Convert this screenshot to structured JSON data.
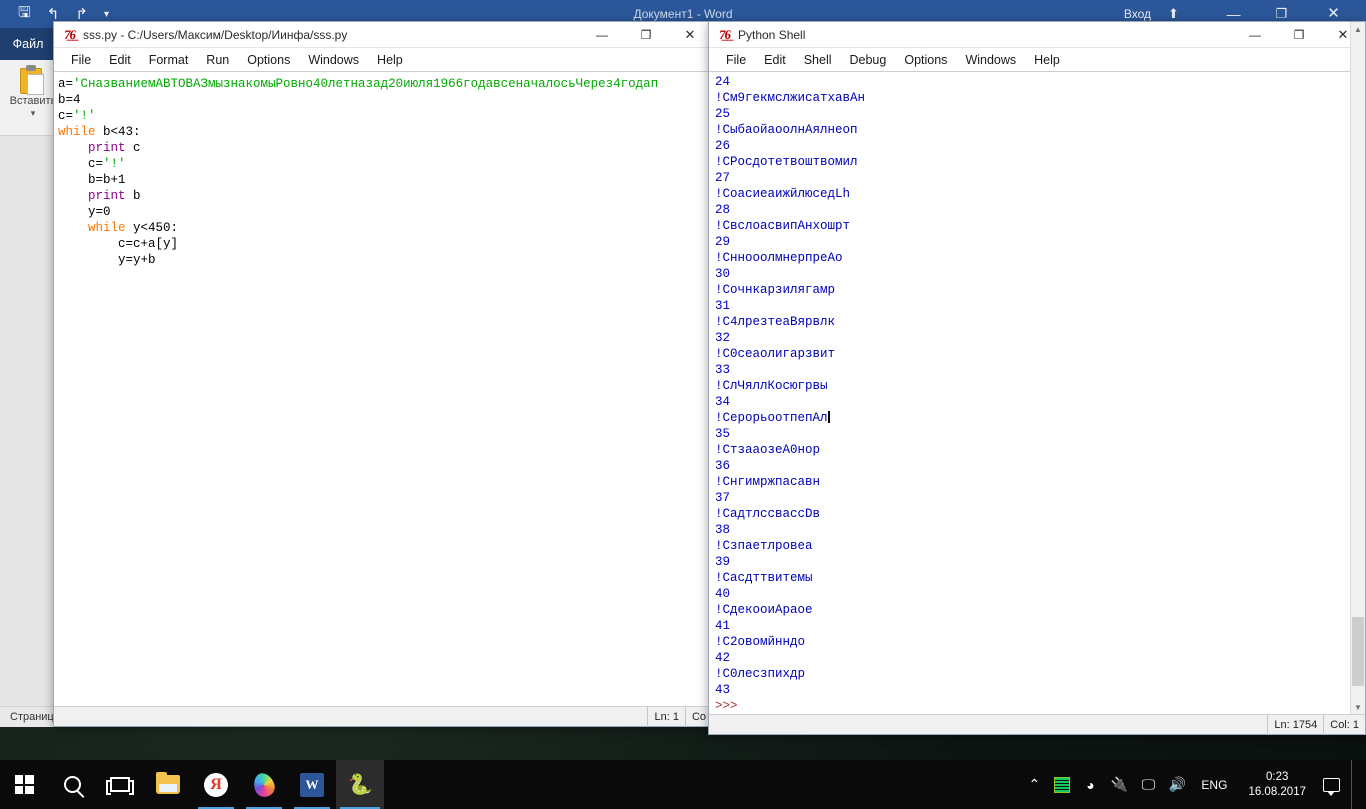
{
  "word": {
    "title": "Документ1 - Word",
    "signin": "Вход",
    "file_tab": "Файл",
    "paste_label": "Вставить",
    "paste_caret": "▾",
    "qat": {
      "save": "🖫",
      "undo": "↰",
      "redo": "↱",
      "more": "▾"
    },
    "titlebar_buttons": {
      "ribbon": "⬆",
      "minimize": "—",
      "maximize": "❐",
      "close": "✕"
    },
    "status": "Страниц"
  },
  "editor": {
    "window_title": "sss.py - C:/Users/Максим/Desktop/Иинфа/sss.py",
    "py_logo": "7̶6̶",
    "menus": [
      "File",
      "Edit",
      "Format",
      "Run",
      "Options",
      "Windows",
      "Help"
    ],
    "buttons": {
      "minimize": "—",
      "maximize": "❐",
      "close": "✕"
    },
    "status": {
      "ln": "Ln: 1",
      "col": "Co"
    },
    "code_lines": [
      [
        {
          "t": "a=",
          "c": "def"
        },
        {
          "t": "'СназваниемАВТОВАЗмызнакомыРовно40летназад20июля1966годавсеначалосьЧерез4годап",
          "c": "str"
        }
      ],
      [
        {
          "t": "b=4",
          "c": "def"
        }
      ],
      [
        {
          "t": "c=",
          "c": "def"
        },
        {
          "t": "'!'",
          "c": "str"
        }
      ],
      [
        {
          "t": "while",
          "c": "kw"
        },
        {
          "t": " b<43:",
          "c": "def"
        }
      ],
      [
        {
          "t": "    ",
          "c": "def"
        },
        {
          "t": "print",
          "c": "bi"
        },
        {
          "t": " c",
          "c": "def"
        }
      ],
      [
        {
          "t": "    c=",
          "c": "def"
        },
        {
          "t": "'!'",
          "c": "str"
        }
      ],
      [
        {
          "t": "    b=b+1",
          "c": "def"
        }
      ],
      [
        {
          "t": "    ",
          "c": "def"
        },
        {
          "t": "print",
          "c": "bi"
        },
        {
          "t": " b",
          "c": "def"
        }
      ],
      [
        {
          "t": "    y=0",
          "c": "def"
        }
      ],
      [
        {
          "t": "    ",
          "c": "def"
        },
        {
          "t": "while",
          "c": "kw"
        },
        {
          "t": " y<450:",
          "c": "def"
        }
      ],
      [
        {
          "t": "        c=c+a[y]",
          "c": "def"
        }
      ],
      [
        {
          "t": "        y=y+b",
          "c": "def"
        }
      ]
    ]
  },
  "shell": {
    "window_title": "Python Shell",
    "menus": [
      "File",
      "Edit",
      "Shell",
      "Debug",
      "Options",
      "Windows",
      "Help"
    ],
    "buttons": {
      "minimize": "—",
      "maximize": "❐",
      "close": "✕"
    },
    "status": {
      "ln": "Ln: 1754",
      "col": "Col: 1"
    },
    "prompt": ">>>",
    "output_lines": [
      "24",
      "!См9гекмслжисатхавАн",
      "25",
      "!СыбаойаоолнАялнеоп",
      "26",
      "!СРосдотетвоштвомил",
      "27",
      "!СоасиеаижйлюседLh",
      "28",
      "!СвслоасвипАнхошрт",
      "29",
      "!СннооолмнерпреАо",
      "30",
      "!Сочнкарзилягамр",
      "31",
      "!С4лрезтеаВярвлк",
      "32",
      "!С0сеаолигарзвит",
      "33",
      "!СлЧяллКосюгрвы",
      "34",
      "!СерорьоотпепАл",
      "35",
      "!СтзааозеА0нор",
      "36",
      "!Снгимржпасавн",
      "37",
      "!СадтлссвассDв",
      "38",
      "!Сзпаетлровеа",
      "39",
      "!Сасдттвитемы",
      "40",
      "!СдекооиАраое",
      "41",
      "!С2овомйнндо",
      "42",
      "!С0лесзпихдр",
      "43"
    ],
    "caret_line_index": 21
  },
  "taskbar": {
    "items": [
      {
        "name": "start-button",
        "label": "Пуск"
      },
      {
        "name": "search-icon",
        "label": "Поиск"
      },
      {
        "name": "task-view-icon",
        "label": "Представление задач"
      },
      {
        "name": "file-explorer-icon",
        "label": "Проводник"
      },
      {
        "name": "yandex-browser-icon",
        "label": "Я"
      },
      {
        "name": "paint-droplet-icon",
        "label": "Paint 3D"
      },
      {
        "name": "word-icon",
        "label": "W"
      },
      {
        "name": "python-idle-icon",
        "label": "🐍"
      }
    ],
    "tray": {
      "chevron": "⌃",
      "equalizer": "equalizer-icon",
      "steam": "steam-icon",
      "battery": "battery-icon",
      "network": "network-icon",
      "volume": "volume-icon",
      "language": "ENG",
      "time": "0:23",
      "date": "16.08.2017",
      "notifications": "notification-icon"
    }
  },
  "colors": {
    "word_blue": "#2b579a",
    "keyword_orange": "#ff7700",
    "string_green": "#00aa00",
    "builtin_purple": "#900090",
    "output_blue": "#0000bb",
    "prompt_red": "#aa3333",
    "taskbar_black": "#0a0a0a"
  }
}
